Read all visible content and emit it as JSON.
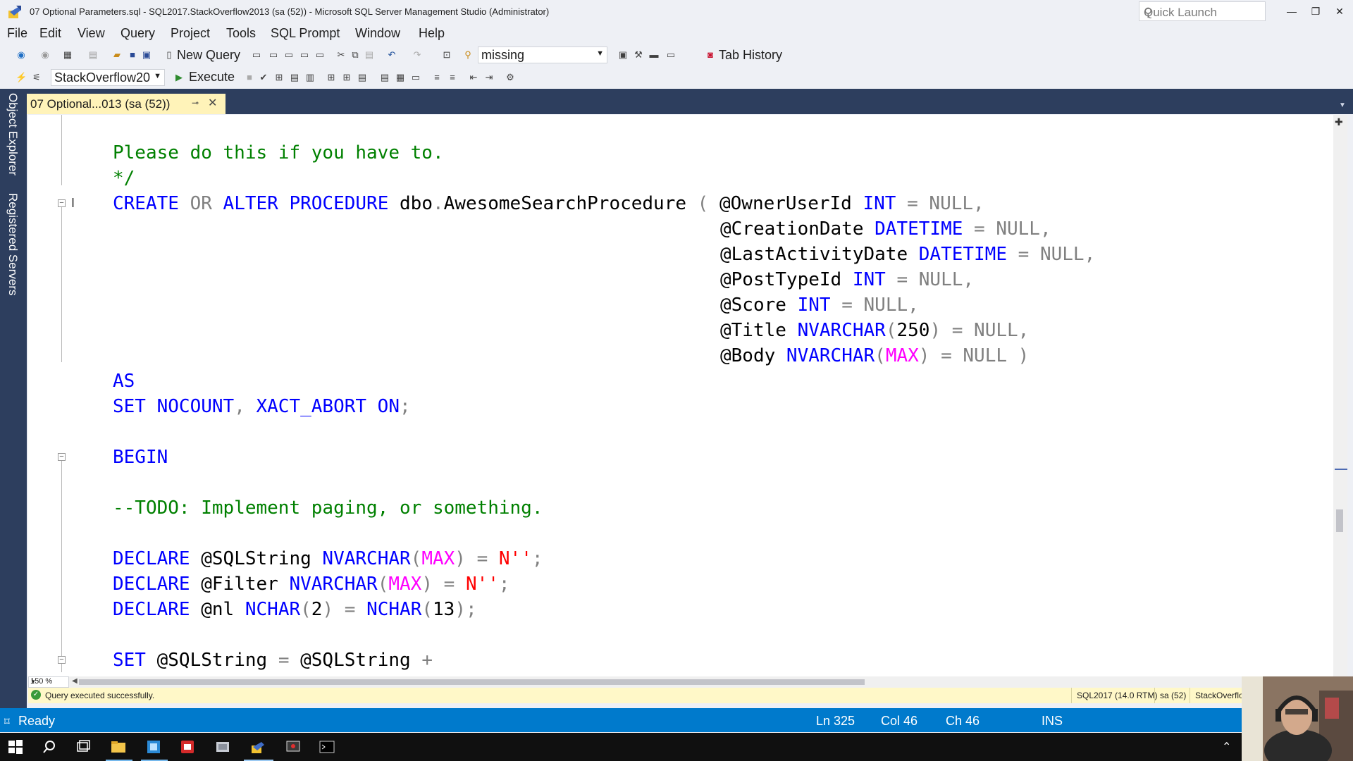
{
  "window": {
    "title": "07 Optional Parameters.sql - SQL2017.StackOverflow2013 (sa (52)) - Microsoft SQL Server Management Studio (Administrator)",
    "quick_launch_placeholder": "Quick Launch",
    "controls": [
      "minimize-icon",
      "restore-icon",
      "close-icon"
    ]
  },
  "menu": [
    "File",
    "Edit",
    "View",
    "Query",
    "Project",
    "Tools",
    "SQL Prompt",
    "Window",
    "Help"
  ],
  "toolbar1": {
    "new_query_label": "New Query",
    "search_combo_value": "missing",
    "tab_history_label": "Tab History"
  },
  "toolbar2": {
    "database_combo_value": "StackOverflow20",
    "execute_label": "Execute"
  },
  "sidebar": {
    "object_explorer": "Object Explorer",
    "registered_servers": "Registered Servers"
  },
  "doc_tab": {
    "label": "07 Optional...013 (sa (52))",
    "pin_glyph": "⊸",
    "close_glyph": "✕"
  },
  "code": {
    "line1": "Please do this if you have to.",
    "line2": "*/",
    "l3": [
      "CREATE",
      " OR ",
      "ALTER PROCEDURE",
      " dbo",
      ".",
      "AwesomeSearchProcedure ",
      "( ",
      "@OwnerUserId ",
      "INT",
      " = NULL,"
    ],
    "l4": [
      "@CreationDate ",
      "DATETIME",
      " = NULL,"
    ],
    "l5": [
      "@LastActivityDate ",
      "DATETIME",
      " = NULL,"
    ],
    "l6": [
      "@PostTypeId ",
      "INT",
      " = NULL,"
    ],
    "l7": [
      "@Score ",
      "INT",
      " = NULL,"
    ],
    "l8": [
      "@Title ",
      "NVARCHAR",
      "(",
      "250",
      ") = NULL,"
    ],
    "l9": [
      "@Body ",
      "NVARCHAR",
      "(",
      "MAX",
      ") = NULL )"
    ],
    "l10": "AS",
    "l11": [
      "SET NOCOUNT",
      ", ",
      "XACT_ABORT ON",
      ";"
    ],
    "l12": "BEGIN",
    "l13": "--TODO: Implement paging, or something.",
    "l14": [
      "DECLARE ",
      "@SQLString ",
      "NVARCHAR",
      "(",
      "MAX",
      ") = ",
      "N''",
      ";"
    ],
    "l15": [
      "DECLARE ",
      "@Filter ",
      "NVARCHAR",
      "(",
      "MAX",
      ") = ",
      "N''",
      ";"
    ],
    "l16": [
      "DECLARE ",
      "@nl ",
      "NCHAR",
      "(",
      "2",
      ") = ",
      "NCHAR",
      "(",
      "13",
      ");"
    ],
    "l17": [
      "SET ",
      "@SQLString ",
      "= ",
      "@SQLString ",
      "+"
    ]
  },
  "editor": {
    "zoom": "150 %"
  },
  "query_status": {
    "message": "Query executed successfully.",
    "server": "SQL2017 (14.0 RTM)",
    "user": "sa (52)",
    "database": "StackOverflo"
  },
  "status_bar": {
    "state": "Ready",
    "ln": "Ln 325",
    "col": "Col 46",
    "ch": "Ch 46",
    "mode": "INS"
  },
  "colors": {
    "keyword": "#0000ff",
    "operator": "#808080",
    "comment": "#008000",
    "function": "#ff00ff",
    "string": "#ff0000",
    "statusbar": "#007acc",
    "tab_active": "#fff3b9",
    "chrome_dark": "#2d3e5e"
  }
}
